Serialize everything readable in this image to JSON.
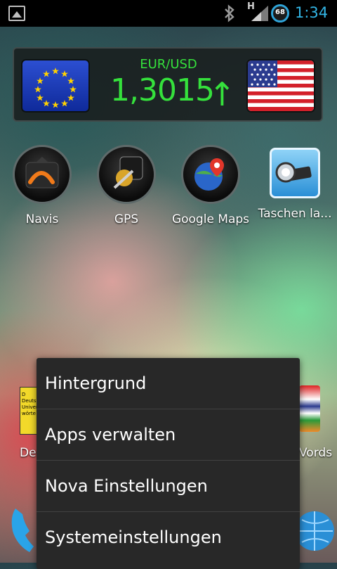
{
  "status_bar": {
    "network_type": "H",
    "battery_level": "68",
    "time": "1:34",
    "icons": [
      "picture-notification-icon",
      "bluetooth-icon",
      "signal-icon",
      "battery-icon"
    ]
  },
  "widget": {
    "currency_pair": "EUR/USD",
    "rate": "1,3015",
    "trend_arrow": "↑",
    "accent_color": "#35e13c"
  },
  "apps": [
    {
      "label": "Navis",
      "icon": "navis-app-icon"
    },
    {
      "label": "GPS",
      "icon": "gps-app-icon"
    },
    {
      "label": "Google Maps",
      "icon": "google-maps-app-icon"
    },
    {
      "label": "Taschen la...",
      "icon": "flashlight-app-icon"
    }
  ],
  "partial_apps": {
    "left_label": "Deu",
    "right_label": "Vords",
    "left_icon_text": "D\nDeuts\nUniver\nwörte"
  },
  "menu": {
    "items": [
      "Hintergrund",
      "Apps verwalten",
      "Nova Einstellungen",
      "Systemeinstellungen"
    ]
  }
}
